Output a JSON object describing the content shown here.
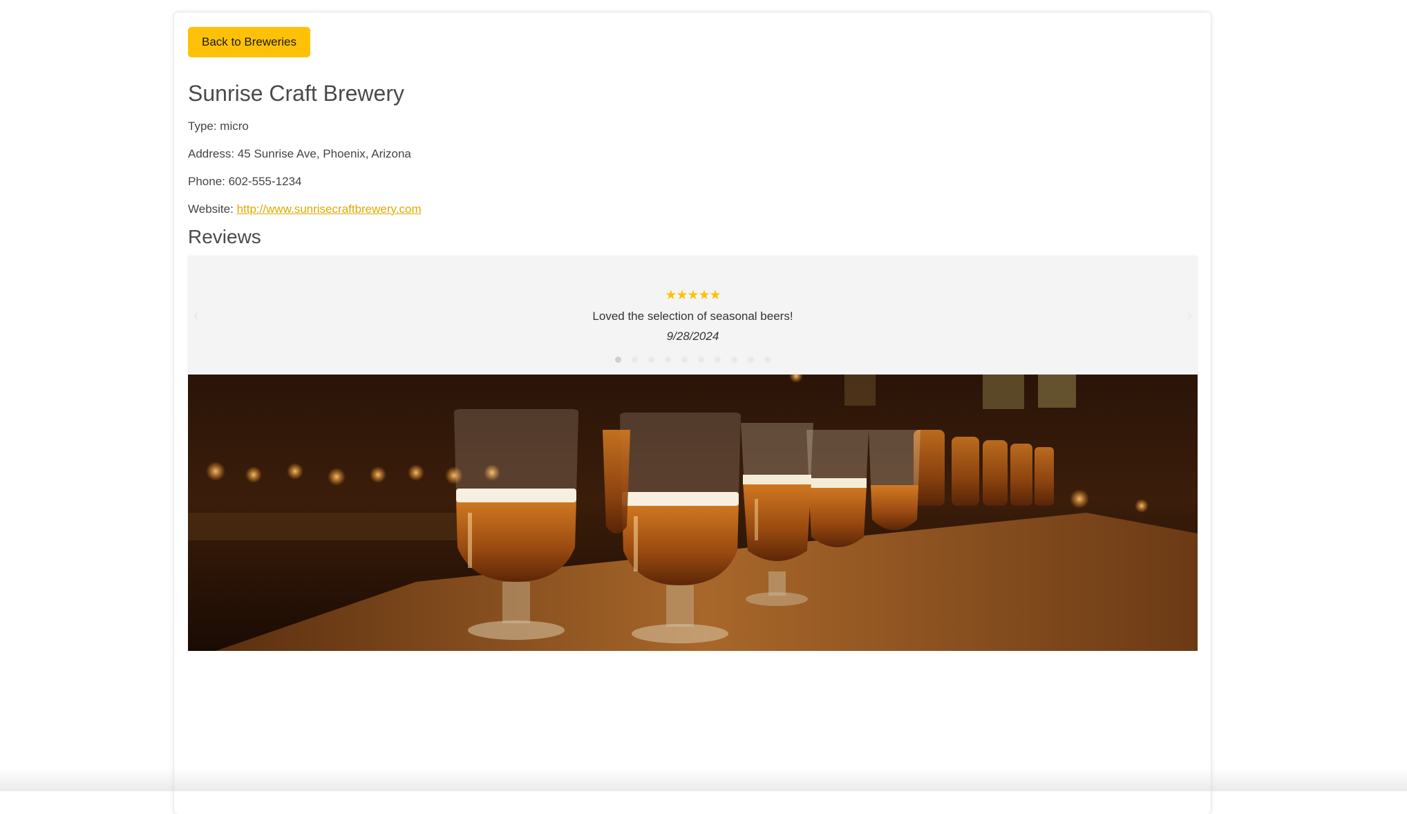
{
  "nav": {
    "back_label": "Back to Breweries"
  },
  "brewery": {
    "name": "Sunrise Craft Brewery",
    "type_text": "Type: micro",
    "address_text": "Address: 45 Sunrise Ave, Phoenix, Arizona",
    "phone_text": "Phone: 602-555-1234",
    "website_prefix": "Website: ",
    "website_url": "http://www.sunrisecraftbrewery.com"
  },
  "reviews": {
    "heading": "Reviews",
    "current": {
      "stars": "★★★★★",
      "rating": 5,
      "text": "Loved the selection of seasonal beers!",
      "date": "9/28/2024"
    },
    "prev_icon": "‹",
    "next_icon": "›",
    "slide_count": 10,
    "active_slide": 1
  },
  "colors": {
    "accent": "#ffc107",
    "link": "#e0a800",
    "carousel_bg": "#f4f4f4"
  }
}
